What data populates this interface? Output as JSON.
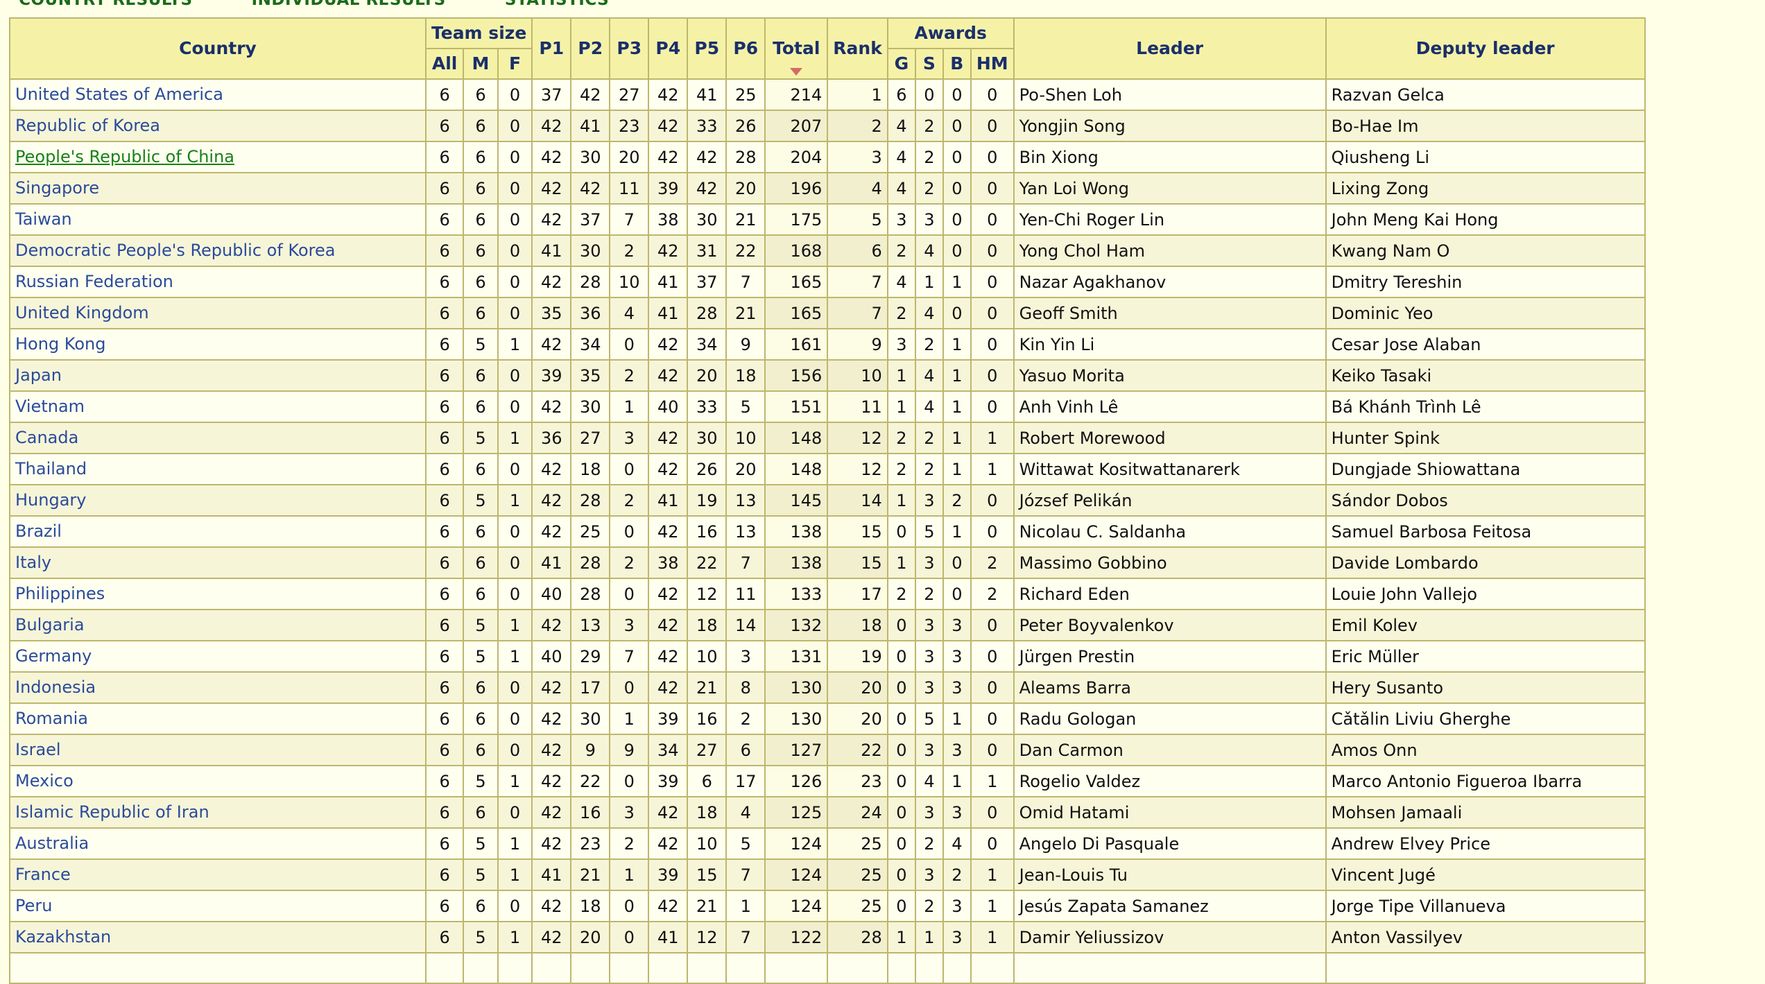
{
  "topnav": {
    "items": [
      "COUNTRY RESULTS",
      "INDIVIDUAL RESULTS",
      "STATISTICS"
    ]
  },
  "table": {
    "headers": {
      "country": "Country",
      "team_size": "Team size",
      "team_all": "All",
      "team_m": "M",
      "team_f": "F",
      "p1": "P1",
      "p2": "P2",
      "p3": "P3",
      "p4": "P4",
      "p5": "P5",
      "p6": "P6",
      "total": "Total",
      "rank": "Rank",
      "awards": "Awards",
      "gold": "G",
      "silver": "S",
      "bronze": "B",
      "hm": "HM",
      "leader": "Leader",
      "deputy_leader": "Deputy leader"
    },
    "sorted_column": "Total",
    "sort_direction": "descending",
    "colors": {
      "header_bg": "#f5f2a8",
      "link_blue": "#2a4b9b",
      "hover_green": "#178217",
      "border": "#bdb76b",
      "row_odd": "#fffff0",
      "row_even": "#f7f5d8",
      "sort_arrow": "#d46a6a",
      "page_bg": "#ffffe8"
    },
    "rows": [
      {
        "country": "United States of America",
        "hovered": false,
        "all": "6",
        "m": "6",
        "f": "0",
        "p1": "37",
        "p2": "42",
        "p3": "27",
        "p4": "42",
        "p5": "41",
        "p6": "25",
        "total": "214",
        "rank": "1",
        "g": "6",
        "s": "0",
        "b": "0",
        "hm": "0",
        "leader": "Po-Shen Loh",
        "deputy": "Razvan Gelca"
      },
      {
        "country": "Republic of Korea",
        "hovered": false,
        "all": "6",
        "m": "6",
        "f": "0",
        "p1": "42",
        "p2": "41",
        "p3": "23",
        "p4": "42",
        "p5": "33",
        "p6": "26",
        "total": "207",
        "rank": "2",
        "g": "4",
        "s": "2",
        "b": "0",
        "hm": "0",
        "leader": "Yongjin Song",
        "deputy": "Bo-Hae Im"
      },
      {
        "country": "People's Republic of China",
        "hovered": true,
        "all": "6",
        "m": "6",
        "f": "0",
        "p1": "42",
        "p2": "30",
        "p3": "20",
        "p4": "42",
        "p5": "42",
        "p6": "28",
        "total": "204",
        "rank": "3",
        "g": "4",
        "s": "2",
        "b": "0",
        "hm": "0",
        "leader": "Bin Xiong",
        "deputy": "Qiusheng Li"
      },
      {
        "country": "Singapore",
        "hovered": false,
        "all": "6",
        "m": "6",
        "f": "0",
        "p1": "42",
        "p2": "42",
        "p3": "11",
        "p4": "39",
        "p5": "42",
        "p6": "20",
        "total": "196",
        "rank": "4",
        "g": "4",
        "s": "2",
        "b": "0",
        "hm": "0",
        "leader": "Yan Loi Wong",
        "deputy": "Lixing Zong"
      },
      {
        "country": "Taiwan",
        "hovered": false,
        "all": "6",
        "m": "6",
        "f": "0",
        "p1": "42",
        "p2": "37",
        "p3": "7",
        "p4": "38",
        "p5": "30",
        "p6": "21",
        "total": "175",
        "rank": "5",
        "g": "3",
        "s": "3",
        "b": "0",
        "hm": "0",
        "leader": "Yen-Chi Roger Lin",
        "deputy": "John Meng Kai Hong"
      },
      {
        "country": "Democratic People's Republic of Korea",
        "hovered": false,
        "all": "6",
        "m": "6",
        "f": "0",
        "p1": "41",
        "p2": "30",
        "p3": "2",
        "p4": "42",
        "p5": "31",
        "p6": "22",
        "total": "168",
        "rank": "6",
        "g": "2",
        "s": "4",
        "b": "0",
        "hm": "0",
        "leader": "Yong Chol Ham",
        "deputy": "Kwang Nam O"
      },
      {
        "country": "Russian Federation",
        "hovered": false,
        "all": "6",
        "m": "6",
        "f": "0",
        "p1": "42",
        "p2": "28",
        "p3": "10",
        "p4": "41",
        "p5": "37",
        "p6": "7",
        "total": "165",
        "rank": "7",
        "g": "4",
        "s": "1",
        "b": "1",
        "hm": "0",
        "leader": "Nazar Agakhanov",
        "deputy": "Dmitry Tereshin"
      },
      {
        "country": "United Kingdom",
        "hovered": false,
        "all": "6",
        "m": "6",
        "f": "0",
        "p1": "35",
        "p2": "36",
        "p3": "4",
        "p4": "41",
        "p5": "28",
        "p6": "21",
        "total": "165",
        "rank": "7",
        "g": "2",
        "s": "4",
        "b": "0",
        "hm": "0",
        "leader": "Geoff Smith",
        "deputy": "Dominic Yeo"
      },
      {
        "country": "Hong Kong",
        "hovered": false,
        "all": "6",
        "m": "5",
        "f": "1",
        "p1": "42",
        "p2": "34",
        "p3": "0",
        "p4": "42",
        "p5": "34",
        "p6": "9",
        "total": "161",
        "rank": "9",
        "g": "3",
        "s": "2",
        "b": "1",
        "hm": "0",
        "leader": "Kin Yin Li",
        "deputy": "Cesar Jose Alaban"
      },
      {
        "country": "Japan",
        "hovered": false,
        "all": "6",
        "m": "6",
        "f": "0",
        "p1": "39",
        "p2": "35",
        "p3": "2",
        "p4": "42",
        "p5": "20",
        "p6": "18",
        "total": "156",
        "rank": "10",
        "g": "1",
        "s": "4",
        "b": "1",
        "hm": "0",
        "leader": "Yasuo Morita",
        "deputy": "Keiko Tasaki"
      },
      {
        "country": "Vietnam",
        "hovered": false,
        "all": "6",
        "m": "6",
        "f": "0",
        "p1": "42",
        "p2": "30",
        "p3": "1",
        "p4": "40",
        "p5": "33",
        "p6": "5",
        "total": "151",
        "rank": "11",
        "g": "1",
        "s": "4",
        "b": "1",
        "hm": "0",
        "leader": "Anh Vinh Lê",
        "deputy": "Bá Khánh Trình Lê"
      },
      {
        "country": "Canada",
        "hovered": false,
        "all": "6",
        "m": "5",
        "f": "1",
        "p1": "36",
        "p2": "27",
        "p3": "3",
        "p4": "42",
        "p5": "30",
        "p6": "10",
        "total": "148",
        "rank": "12",
        "g": "2",
        "s": "2",
        "b": "1",
        "hm": "1",
        "leader": "Robert Morewood",
        "deputy": "Hunter Spink"
      },
      {
        "country": "Thailand",
        "hovered": false,
        "all": "6",
        "m": "6",
        "f": "0",
        "p1": "42",
        "p2": "18",
        "p3": "0",
        "p4": "42",
        "p5": "26",
        "p6": "20",
        "total": "148",
        "rank": "12",
        "g": "2",
        "s": "2",
        "b": "1",
        "hm": "1",
        "leader": "Wittawat Kositwattanarerk",
        "deputy": "Dungjade Shiowattana"
      },
      {
        "country": "Hungary",
        "hovered": false,
        "all": "6",
        "m": "5",
        "f": "1",
        "p1": "42",
        "p2": "28",
        "p3": "2",
        "p4": "41",
        "p5": "19",
        "p6": "13",
        "total": "145",
        "rank": "14",
        "g": "1",
        "s": "3",
        "b": "2",
        "hm": "0",
        "leader": "József Pelikán",
        "deputy": "Sándor Dobos"
      },
      {
        "country": "Brazil",
        "hovered": false,
        "all": "6",
        "m": "6",
        "f": "0",
        "p1": "42",
        "p2": "25",
        "p3": "0",
        "p4": "42",
        "p5": "16",
        "p6": "13",
        "total": "138",
        "rank": "15",
        "g": "0",
        "s": "5",
        "b": "1",
        "hm": "0",
        "leader": "Nicolau C. Saldanha",
        "deputy": "Samuel Barbosa Feitosa"
      },
      {
        "country": "Italy",
        "hovered": false,
        "all": "6",
        "m": "6",
        "f": "0",
        "p1": "41",
        "p2": "28",
        "p3": "2",
        "p4": "38",
        "p5": "22",
        "p6": "7",
        "total": "138",
        "rank": "15",
        "g": "1",
        "s": "3",
        "b": "0",
        "hm": "2",
        "leader": "Massimo Gobbino",
        "deputy": "Davide Lombardo"
      },
      {
        "country": "Philippines",
        "hovered": false,
        "all": "6",
        "m": "6",
        "f": "0",
        "p1": "40",
        "p2": "28",
        "p3": "0",
        "p4": "42",
        "p5": "12",
        "p6": "11",
        "total": "133",
        "rank": "17",
        "g": "2",
        "s": "2",
        "b": "0",
        "hm": "2",
        "leader": "Richard Eden",
        "deputy": "Louie John Vallejo"
      },
      {
        "country": "Bulgaria",
        "hovered": false,
        "all": "6",
        "m": "5",
        "f": "1",
        "p1": "42",
        "p2": "13",
        "p3": "3",
        "p4": "42",
        "p5": "18",
        "p6": "14",
        "total": "132",
        "rank": "18",
        "g": "0",
        "s": "3",
        "b": "3",
        "hm": "0",
        "leader": "Peter Boyvalenkov",
        "deputy": "Emil Kolev"
      },
      {
        "country": "Germany",
        "hovered": false,
        "all": "6",
        "m": "5",
        "f": "1",
        "p1": "40",
        "p2": "29",
        "p3": "7",
        "p4": "42",
        "p5": "10",
        "p6": "3",
        "total": "131",
        "rank": "19",
        "g": "0",
        "s": "3",
        "b": "3",
        "hm": "0",
        "leader": "Jürgen Prestin",
        "deputy": "Eric Müller"
      },
      {
        "country": "Indonesia",
        "hovered": false,
        "all": "6",
        "m": "6",
        "f": "0",
        "p1": "42",
        "p2": "17",
        "p3": "0",
        "p4": "42",
        "p5": "21",
        "p6": "8",
        "total": "130",
        "rank": "20",
        "g": "0",
        "s": "3",
        "b": "3",
        "hm": "0",
        "leader": "Aleams Barra",
        "deputy": "Hery Susanto"
      },
      {
        "country": "Romania",
        "hovered": false,
        "all": "6",
        "m": "6",
        "f": "0",
        "p1": "42",
        "p2": "30",
        "p3": "1",
        "p4": "39",
        "p5": "16",
        "p6": "2",
        "total": "130",
        "rank": "20",
        "g": "0",
        "s": "5",
        "b": "1",
        "hm": "0",
        "leader": "Radu Gologan",
        "deputy": "Cǎtǎlin Liviu Gherghe"
      },
      {
        "country": "Israel",
        "hovered": false,
        "all": "6",
        "m": "6",
        "f": "0",
        "p1": "42",
        "p2": "9",
        "p3": "9",
        "p4": "34",
        "p5": "27",
        "p6": "6",
        "total": "127",
        "rank": "22",
        "g": "0",
        "s": "3",
        "b": "3",
        "hm": "0",
        "leader": "Dan Carmon",
        "deputy": "Amos Onn"
      },
      {
        "country": "Mexico",
        "hovered": false,
        "all": "6",
        "m": "5",
        "f": "1",
        "p1": "42",
        "p2": "22",
        "p3": "0",
        "p4": "39",
        "p5": "6",
        "p6": "17",
        "total": "126",
        "rank": "23",
        "g": "0",
        "s": "4",
        "b": "1",
        "hm": "1",
        "leader": "Rogelio Valdez",
        "deputy": "Marco Antonio Figueroa Ibarra"
      },
      {
        "country": "Islamic Republic of Iran",
        "hovered": false,
        "all": "6",
        "m": "6",
        "f": "0",
        "p1": "42",
        "p2": "16",
        "p3": "3",
        "p4": "42",
        "p5": "18",
        "p6": "4",
        "total": "125",
        "rank": "24",
        "g": "0",
        "s": "3",
        "b": "3",
        "hm": "0",
        "leader": "Omid Hatami",
        "deputy": "Mohsen Jamaali"
      },
      {
        "country": "Australia",
        "hovered": false,
        "all": "6",
        "m": "5",
        "f": "1",
        "p1": "42",
        "p2": "23",
        "p3": "2",
        "p4": "42",
        "p5": "10",
        "p6": "5",
        "total": "124",
        "rank": "25",
        "g": "0",
        "s": "2",
        "b": "4",
        "hm": "0",
        "leader": "Angelo Di Pasquale",
        "deputy": "Andrew Elvey Price"
      },
      {
        "country": "France",
        "hovered": false,
        "all": "6",
        "m": "5",
        "f": "1",
        "p1": "41",
        "p2": "21",
        "p3": "1",
        "p4": "39",
        "p5": "15",
        "p6": "7",
        "total": "124",
        "rank": "25",
        "g": "0",
        "s": "3",
        "b": "2",
        "hm": "1",
        "leader": "Jean-Louis Tu",
        "deputy": "Vincent Jugé"
      },
      {
        "country": "Peru",
        "hovered": false,
        "all": "6",
        "m": "6",
        "f": "0",
        "p1": "42",
        "p2": "18",
        "p3": "0",
        "p4": "42",
        "p5": "21",
        "p6": "1",
        "total": "124",
        "rank": "25",
        "g": "0",
        "s": "2",
        "b": "3",
        "hm": "1",
        "leader": "Jesús Zapata Samanez",
        "deputy": "Jorge Tipe Villanueva"
      },
      {
        "country": "Kazakhstan",
        "hovered": false,
        "all": "6",
        "m": "5",
        "f": "1",
        "p1": "42",
        "p2": "20",
        "p3": "0",
        "p4": "41",
        "p5": "12",
        "p6": "7",
        "total": "122",
        "rank": "28",
        "g": "1",
        "s": "1",
        "b": "3",
        "hm": "1",
        "leader": "Damir Yeliussizov",
        "deputy": "Anton Vassilyev"
      }
    ]
  }
}
